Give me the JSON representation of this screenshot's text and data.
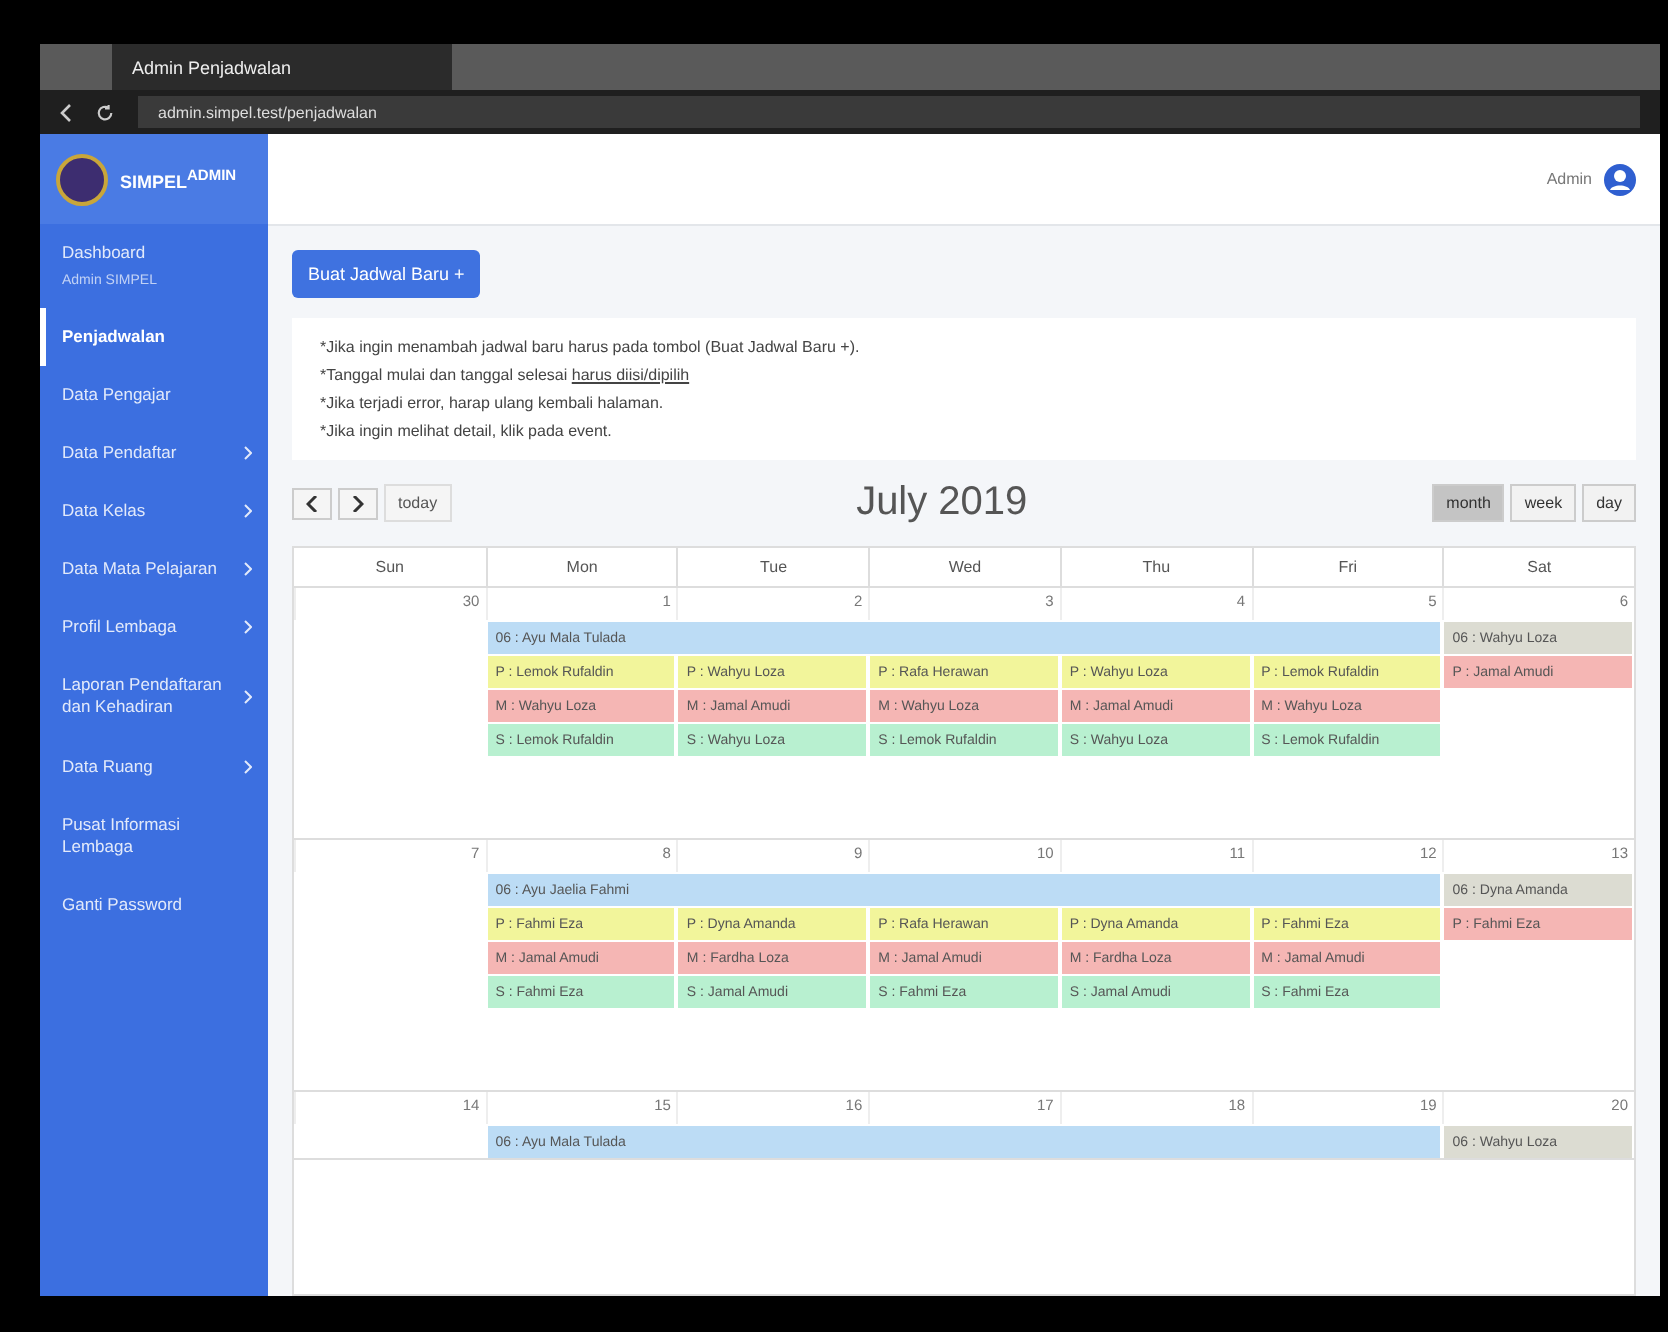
{
  "browser": {
    "tab_title": "Admin Penjadwalan",
    "url": "admin.simpel.test/penjadwalan"
  },
  "sidebar": {
    "brand": "SIMPEL",
    "brand_sup": "ADMIN",
    "items": [
      {
        "label": "Dashboard",
        "sub": "Admin SIMPEL",
        "selected": false,
        "has_children": false
      },
      {
        "label": "Penjadwalan",
        "selected": true,
        "has_children": false
      },
      {
        "label": "Data Pengajar",
        "selected": false,
        "has_children": false
      },
      {
        "label": "Data Pendaftar",
        "selected": false,
        "has_children": true
      },
      {
        "label": "Data Kelas",
        "selected": false,
        "has_children": true
      },
      {
        "label": "Data Mata Pelajaran",
        "selected": false,
        "has_children": true
      },
      {
        "label": "Profil Lembaga",
        "selected": false,
        "has_children": true
      },
      {
        "label": "Laporan Pendaftaran dan Kehadiran",
        "selected": false,
        "has_children": true
      },
      {
        "label": "Data Ruang",
        "selected": false,
        "has_children": true
      },
      {
        "label": "Pusat Informasi Lembaga",
        "selected": false,
        "has_children": false
      },
      {
        "label": "Ganti Password",
        "selected": false,
        "has_children": false
      }
    ]
  },
  "header": {
    "user": "Admin"
  },
  "new_button": "Buat Jadwal Baru +",
  "notes": [
    "*Jika ingin menambah jadwal baru harus pada tombol (Buat Jadwal Baru +).",
    "*Tanggal mulai dan tanggal selesai **harus diisi/dipilih**",
    "*Jika terjadi error, harap ulang kembali halaman.",
    "*Jika ingin melihat detail, klik pada event."
  ],
  "calendar": {
    "title": "July 2019",
    "today": "today",
    "views": [
      {
        "label": "month",
        "selected": true
      },
      {
        "label": "week",
        "selected": false
      },
      {
        "label": "day",
        "selected": false
      }
    ],
    "weekdays": [
      "Sun",
      "Mon",
      "Tue",
      "Wed",
      "Thu",
      "Fri",
      "Sat"
    ],
    "weeks": [
      {
        "days": [
          "30",
          "1",
          "2",
          "3",
          "4",
          "5",
          "6"
        ],
        "banner": {
          "text": "06 : Ayu Mala Tulada",
          "color": "#bcdcf5"
        },
        "day_events": {
          "mon": [
            {
              "text": "P : Lemok Rufaldin",
              "color": "#f2f59b"
            },
            {
              "text": "M : Wahyu Loza",
              "color": "#f5b6b4"
            },
            {
              "text": "S : Lemok Rufaldin",
              "color": "#b8f0d0"
            }
          ],
          "tue": [
            {
              "text": "P : Wahyu Loza",
              "color": "#f2f59b"
            },
            {
              "text": "M : Jamal Amudi",
              "color": "#f5b6b4"
            },
            {
              "text": "S : Wahyu Loza",
              "color": "#b8f0d0"
            }
          ],
          "wed": [
            {
              "text": "P : Rafa Herawan",
              "color": "#f2f59b"
            },
            {
              "text": "M : Wahyu Loza",
              "color": "#f5b6b4"
            },
            {
              "text": "S : Lemok Rufaldin",
              "color": "#b8f0d0"
            }
          ],
          "thu": [
            {
              "text": "P : Wahyu Loza",
              "color": "#f2f59b"
            },
            {
              "text": "M : Jamal Amudi",
              "color": "#f5b6b4"
            },
            {
              "text": "S : Wahyu Loza",
              "color": "#b8f0d0"
            }
          ],
          "fri": [
            {
              "text": "P : Lemok Rufaldin",
              "color": "#f2f59b"
            },
            {
              "text": "M : Wahyu Loza",
              "color": "#f5b6b4"
            },
            {
              "text": "S : Lemok Rufaldin",
              "color": "#b8f0d0"
            }
          ],
          "sat": [
            {
              "text": "06 : Wahyu Loza",
              "color": "#dcdcd2"
            },
            {
              "text": "P : Jamal Amudi",
              "color": "#f5b6b4"
            }
          ]
        }
      },
      {
        "days": [
          "7",
          "8",
          "9",
          "10",
          "11",
          "12",
          "13"
        ],
        "banner": {
          "text": "06 : Ayu Jaelia Fahmi",
          "color": "#bcdcf5"
        },
        "day_events": {
          "mon": [
            {
              "text": "P : Fahmi Eza",
              "color": "#f2f59b"
            },
            {
              "text": "M : Jamal Amudi",
              "color": "#f5b6b4"
            },
            {
              "text": "S : Fahmi Eza",
              "color": "#b8f0d0"
            }
          ],
          "tue": [
            {
              "text": "P : Dyna Amanda",
              "color": "#f2f59b"
            },
            {
              "text": "M : Fardha Loza",
              "color": "#f5b6b4"
            },
            {
              "text": "S : Jamal Amudi",
              "color": "#b8f0d0"
            }
          ],
          "wed": [
            {
              "text": "P : Rafa Herawan",
              "color": "#f2f59b"
            },
            {
              "text": "M : Jamal Amudi",
              "color": "#f5b6b4"
            },
            {
              "text": "S : Fahmi Eza",
              "color": "#b8f0d0"
            }
          ],
          "thu": [
            {
              "text": "P : Dyna Amanda",
              "color": "#f2f59b"
            },
            {
              "text": "M : Fardha Loza",
              "color": "#f5b6b4"
            },
            {
              "text": "S : Jamal Amudi",
              "color": "#b8f0d0"
            }
          ],
          "fri": [
            {
              "text": "P : Fahmi Eza",
              "color": "#f2f59b"
            },
            {
              "text": "M : Jamal Amudi",
              "color": "#f5b6b4"
            },
            {
              "text": "S : Fahmi Eza",
              "color": "#b8f0d0"
            }
          ],
          "sat": [
            {
              "text": "06 : Dyna Amanda",
              "color": "#dcdcd2"
            },
            {
              "text": "P : Fahmi Eza",
              "color": "#f5b6b4"
            }
          ]
        }
      },
      {
        "days": [
          "14",
          "15",
          "16",
          "17",
          "18",
          "19",
          "20"
        ],
        "banner": {
          "text": "06 : Ayu Mala Tulada",
          "color": "#bcdcf5"
        },
        "day_events": {
          "sat": [
            {
              "text": "06 : Wahyu Loza",
              "color": "#dcdcd2"
            }
          ]
        }
      }
    ]
  }
}
